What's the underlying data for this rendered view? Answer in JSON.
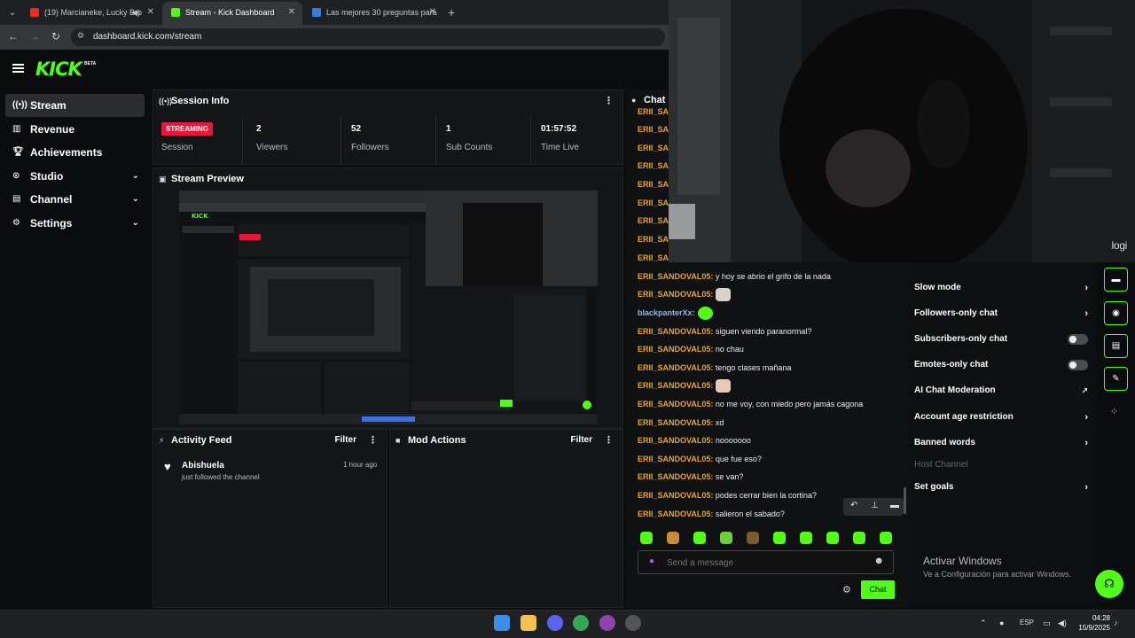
{
  "browser": {
    "tabs": [
      {
        "label": "(19) Marcianeke, Lucky Bro"
      },
      {
        "label": "Stream - Kick Dashboard"
      },
      {
        "label": "Las mejores 30 preguntas para"
      }
    ],
    "url": "dashboard.kick.com/stream"
  },
  "brand": {
    "logo": "KICK",
    "badge": "BETA",
    "accent": "#53fc18"
  },
  "sidebar": {
    "items": [
      {
        "label": "Stream",
        "icon": "broadcast-icon"
      },
      {
        "label": "Revenue",
        "icon": "revenue-icon"
      },
      {
        "label": "Achievements",
        "icon": "trophy-icon"
      },
      {
        "label": "Studio",
        "icon": "studio-icon"
      },
      {
        "label": "Channel",
        "icon": "channel-icon"
      },
      {
        "label": "Settings",
        "icon": "gear-icon"
      }
    ]
  },
  "session": {
    "title": "Session Info",
    "status": "STREAMING",
    "status_label": "Session",
    "viewers": "2",
    "viewers_label": "Viewers",
    "followers": "52",
    "followers_label": "Followers",
    "subs": "1",
    "subs_label": "Sub Counts",
    "time": "01:57:52",
    "time_label": "Time Live"
  },
  "preview": {
    "title": "Stream Preview"
  },
  "activity": {
    "title": "Activity Feed",
    "filter": "Filter",
    "items": [
      {
        "name": "Abishuela",
        "time": "1 hour ago",
        "desc": "just followed the channel"
      }
    ]
  },
  "mod": {
    "title": "Mod Actions",
    "filter": "Filter"
  },
  "chat": {
    "title": "Chat",
    "messages": [
      {
        "user": "ERII_SANDOVAL05:",
        "text": " y hoy se abrio el grifo de la nada"
      },
      {
        "user": "ERII_SANDOVAL05:",
        "text": ""
      },
      {
        "user": "blackpanterXx:",
        "text": ""
      },
      {
        "user": "ERII_SANDOVAL05:",
        "text": " siguen viendo paranormal?"
      },
      {
        "user": "ERII_SANDOVAL05:",
        "text": " no chau"
      },
      {
        "user": "ERII_SANDOVAL05:",
        "text": " tengo clases mañana"
      },
      {
        "user": "ERII_SANDOVAL05:",
        "text": ""
      },
      {
        "user": "ERII_SANDOVAL05:",
        "text": " no me voy, con miedo pero jamás cagona"
      },
      {
        "user": "ERII_SANDOVAL05:",
        "text": " xd"
      },
      {
        "user": "ERII_SANDOVAL05:",
        "text": " nooooooo"
      },
      {
        "user": "ERII_SANDOVAL05:",
        "text": " que fue eso?"
      },
      {
        "user": "ERII_SANDOVAL05:",
        "text": " se van?"
      },
      {
        "user": "ERII_SANDOVAL05:",
        "text": " podes cerrar bien la cortina?"
      },
      {
        "user": "ERII_SANDOVAL05:",
        "text": " salieron el sabado?"
      }
    ],
    "hidden_user": "ERII_SAND",
    "placeholder": "Send a message",
    "send_label": "Chat"
  },
  "settings": {
    "items": [
      {
        "label": "Slow mode",
        "control": "arrow"
      },
      {
        "label": "Followers-only chat",
        "control": "arrow"
      },
      {
        "label": "Subscribers-only chat",
        "control": "toggle"
      },
      {
        "label": "Emotes-only chat",
        "control": "toggle"
      },
      {
        "label": "AI Chat Moderation",
        "control": "external"
      },
      {
        "label": "Account age restriction",
        "control": "arrow"
      },
      {
        "label": "Banned words",
        "control": "arrow"
      },
      {
        "label": "Host Channel",
        "control": "none"
      },
      {
        "label": "Set goals",
        "control": "arrow"
      }
    ]
  },
  "webcam": {
    "brand": "logi"
  },
  "windows": {
    "activate_title": "Activar Windows",
    "activate_desc": "Ve a Configuración para activar Windows.",
    "lang": "ESP",
    "time": "04:28",
    "date": "15/9/2025"
  }
}
